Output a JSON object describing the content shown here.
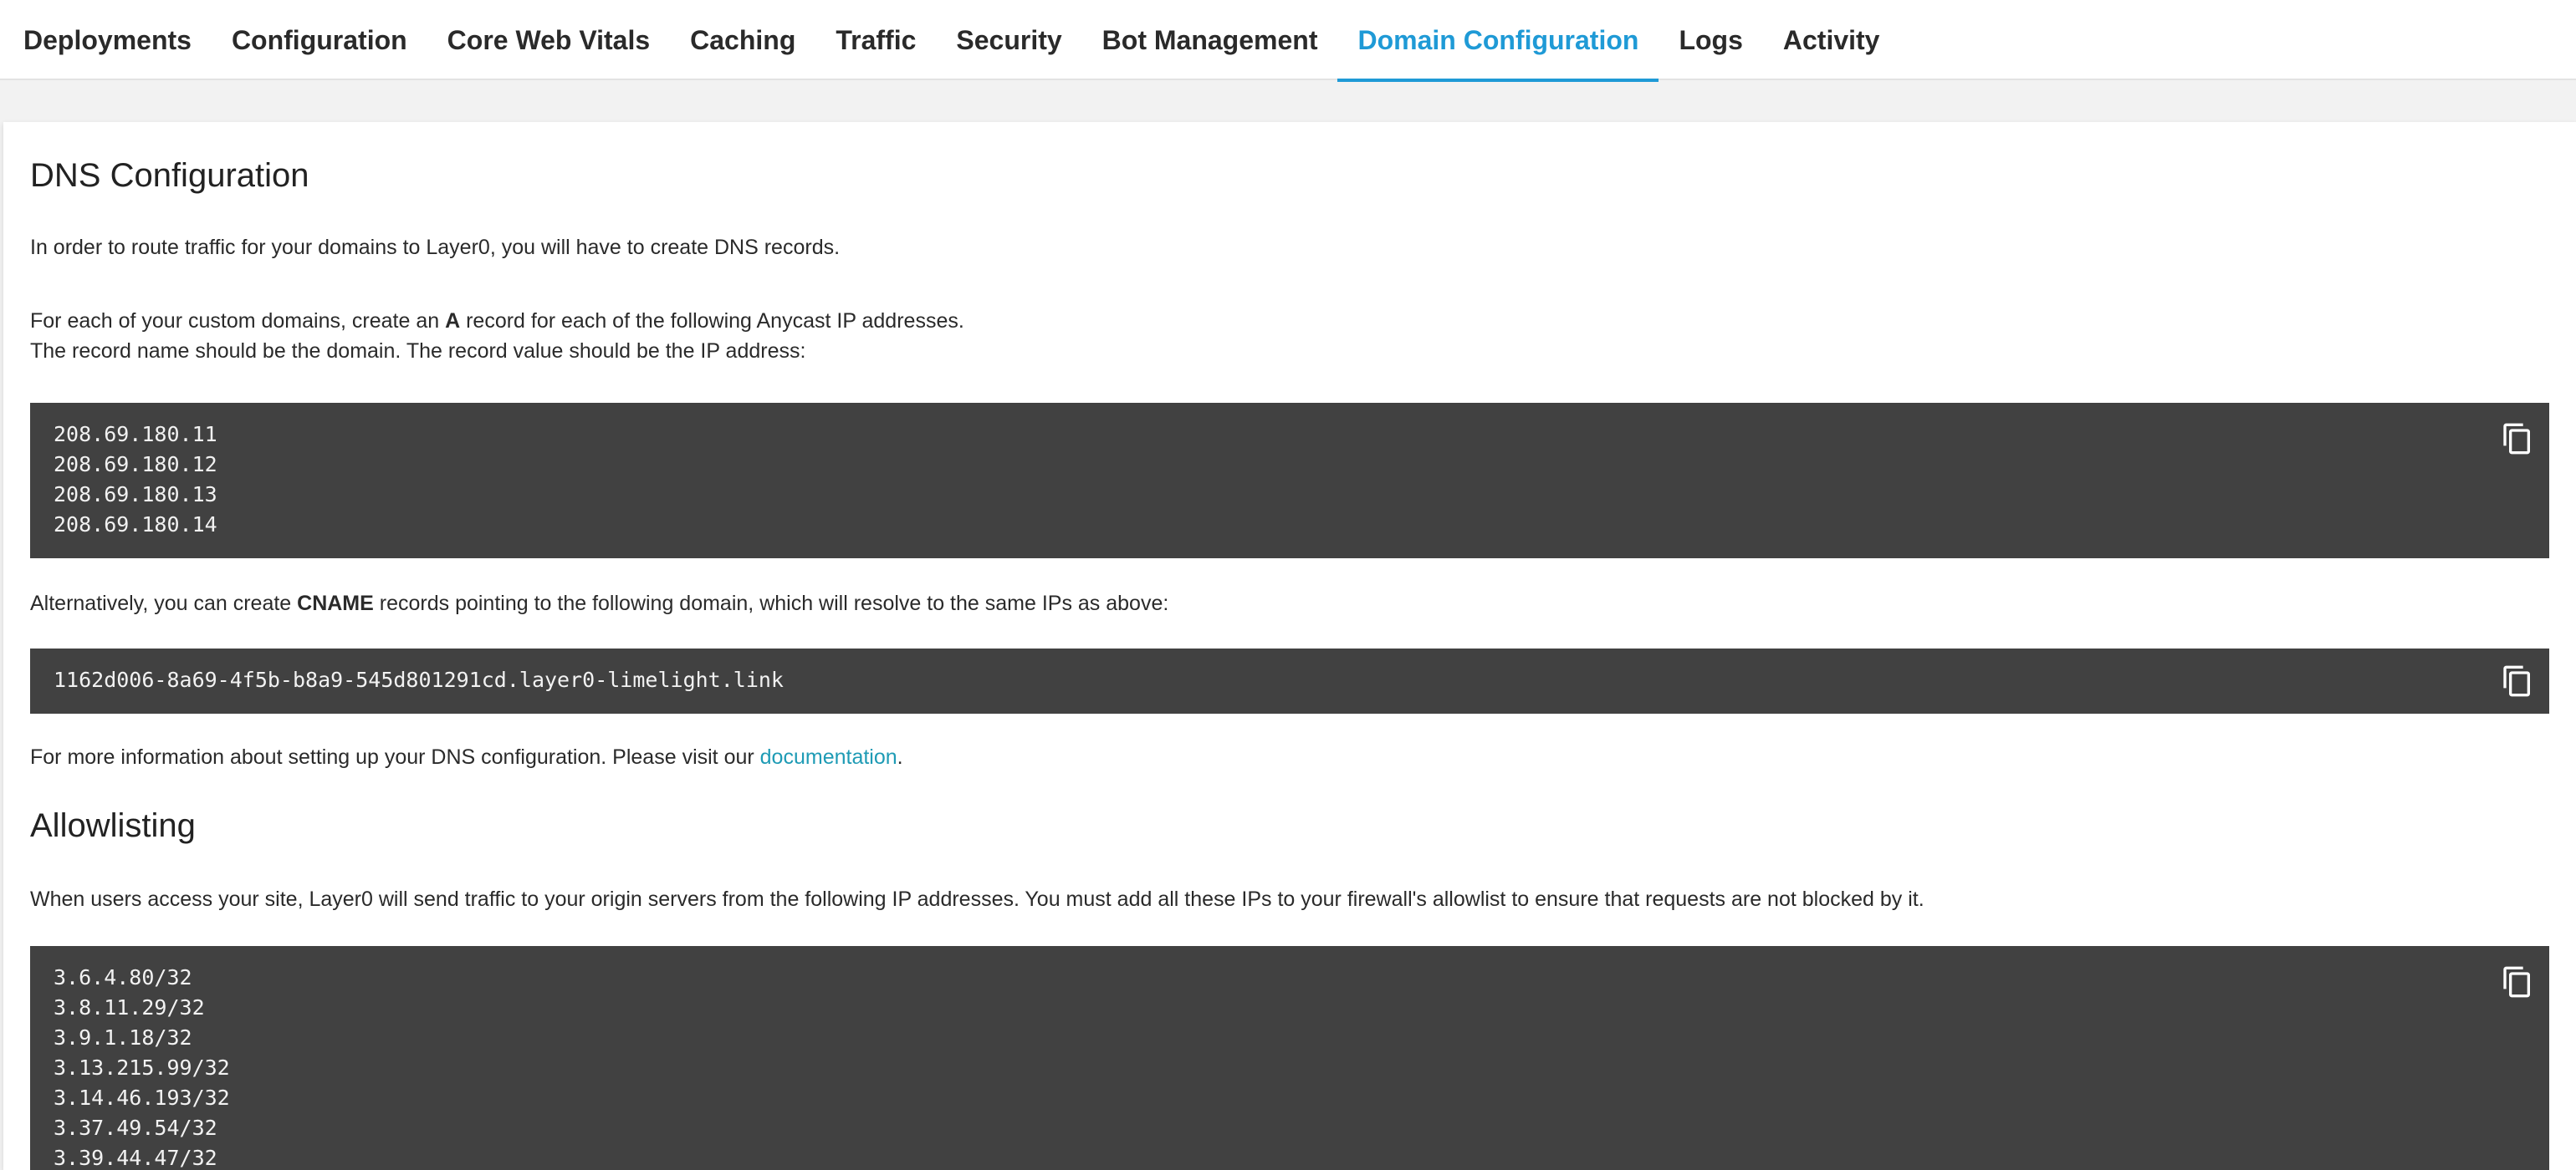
{
  "tabs": [
    {
      "label": "Deployments",
      "active": false
    },
    {
      "label": "Configuration",
      "active": false
    },
    {
      "label": "Core Web Vitals",
      "active": false
    },
    {
      "label": "Caching",
      "active": false
    },
    {
      "label": "Traffic",
      "active": false
    },
    {
      "label": "Security",
      "active": false
    },
    {
      "label": "Bot Management",
      "active": false
    },
    {
      "label": "Domain Configuration",
      "active": true
    },
    {
      "label": "Logs",
      "active": false
    },
    {
      "label": "Activity",
      "active": false
    }
  ],
  "dns": {
    "title": "DNS Configuration",
    "intro": "In order to route traffic for your domains to Layer0, you will have to create DNS records.",
    "a_record_pre": "For each of your custom domains, create an ",
    "a_record_bold": "A",
    "a_record_post": " record for each of the following Anycast IP addresses.",
    "record_name": "The record name should be the domain. The record value should be the IP address:",
    "ips": [
      "208.69.180.11",
      "208.69.180.12",
      "208.69.180.13",
      "208.69.180.14"
    ],
    "cname_pre": "Alternatively, you can create ",
    "cname_bold": "CNAME",
    "cname_post": " records pointing to the following domain, which will resolve to the same IPs as above:",
    "cname_value": "1162d006-8a69-4f5b-b8a9-545d801291cd.layer0-limelight.link",
    "more_pre": "For more information about setting up your DNS configuration. Please visit our ",
    "more_link": "documentation",
    "more_post": "."
  },
  "allowlist": {
    "title": "Allowlisting",
    "description": "When users access your site, Layer0 will send traffic to your origin servers from the following IP addresses. You must add all these IPs to your firewall's allowlist to ensure that requests are not blocked by it.",
    "ips": [
      "3.6.4.80/32",
      "3.8.11.29/32",
      "3.9.1.18/32",
      "3.13.215.99/32",
      "3.14.46.193/32",
      "3.37.49.54/32",
      "3.39.44.47/32"
    ]
  },
  "icons": {
    "copy": "copy-icon"
  },
  "colors": {
    "accent": "#1f9ad6",
    "link": "#1e9bb5",
    "code_bg": "#414141"
  }
}
